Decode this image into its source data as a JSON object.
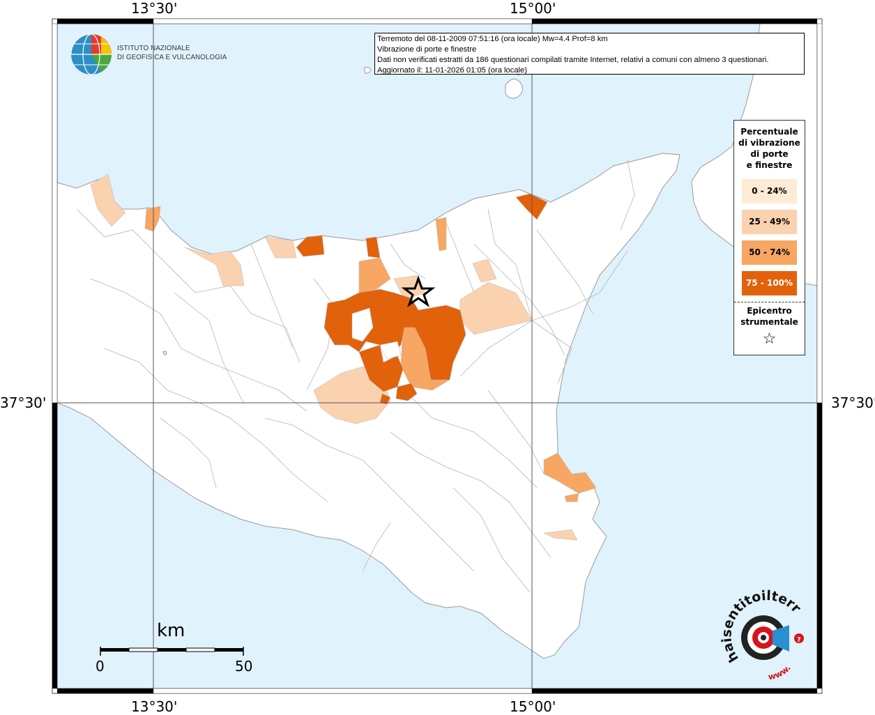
{
  "coordinates": {
    "top_left": "13°30'",
    "top_right": "15°00'",
    "bottom_left": "13°30'",
    "bottom_right": "15°00'",
    "left": "37°30'",
    "right": "37°30'"
  },
  "info_box": {
    "line1": "Terremoto del 08-11-2009 07:51:16 (ora locale) Mw=4.4 Prof=8 km",
    "line2": "Vibrazione di porte e finestre",
    "line3": "Dati non verificati estratti da 186 questionari compilati tramite Internet, relativi a comuni con almeno 3 questionari.",
    "line4": "Aggiornato il: 11-01-2026 01:05 (ora locale)"
  },
  "ingv": {
    "line1": "ISTITUTO NAZIONALE",
    "line2": "DI GEOFISICA E VULCANOLOGIA"
  },
  "legend": {
    "title1": "Percentuale",
    "title2": "di vibrazione",
    "title3": "di porte",
    "title4": "e finestre",
    "items": [
      {
        "label": "0 - 24%",
        "color": "#fdebd5"
      },
      {
        "label": "25 - 49%",
        "color": "#fbd2b0"
      },
      {
        "label": "50 - 74%",
        "color": "#f7a663"
      },
      {
        "label": "75 - 100%",
        "color": "#e2620c"
      }
    ],
    "epicenter1": "Epicentro",
    "epicenter2": "strumentale",
    "star": "☆"
  },
  "scale": {
    "unit": "km",
    "start": "0",
    "end": "50"
  },
  "hsit_logo": {
    "text": "haisentitoilterremoto.it",
    "www": "www."
  },
  "colors": {
    "sea": "#e0f2fb",
    "land": "#ffffff",
    "border": "#a8a8a8"
  }
}
